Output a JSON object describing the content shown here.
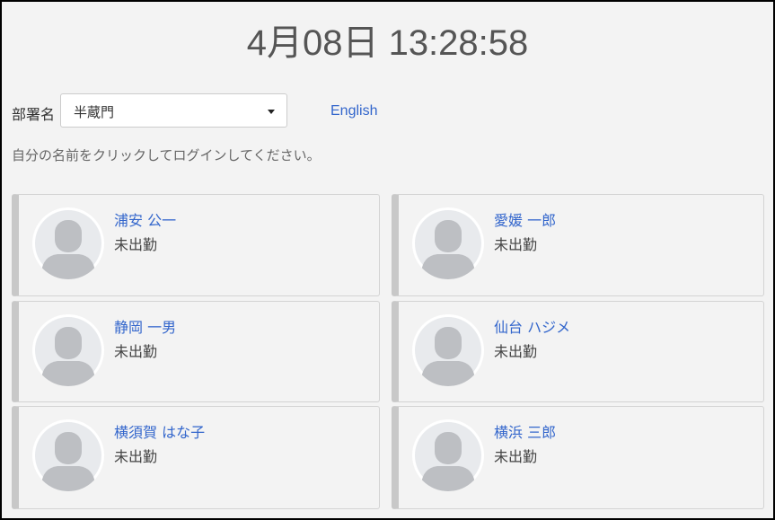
{
  "header": {
    "clock": "4月08日 13:28:58"
  },
  "department": {
    "label": "部署名",
    "selected": "半蔵門"
  },
  "language_link": "English",
  "instruction": "自分の名前をクリックしてログインしてください。",
  "employees": [
    {
      "name": "浦安 公一",
      "status": "未出勤"
    },
    {
      "name": "愛媛 一郎",
      "status": "未出勤"
    },
    {
      "name": "静岡 一男",
      "status": "未出勤"
    },
    {
      "name": "仙台 ハジメ",
      "status": "未出勤"
    },
    {
      "name": "横須賀 はな子",
      "status": "未出勤"
    },
    {
      "name": "横浜 三郎",
      "status": "未出勤"
    }
  ]
}
